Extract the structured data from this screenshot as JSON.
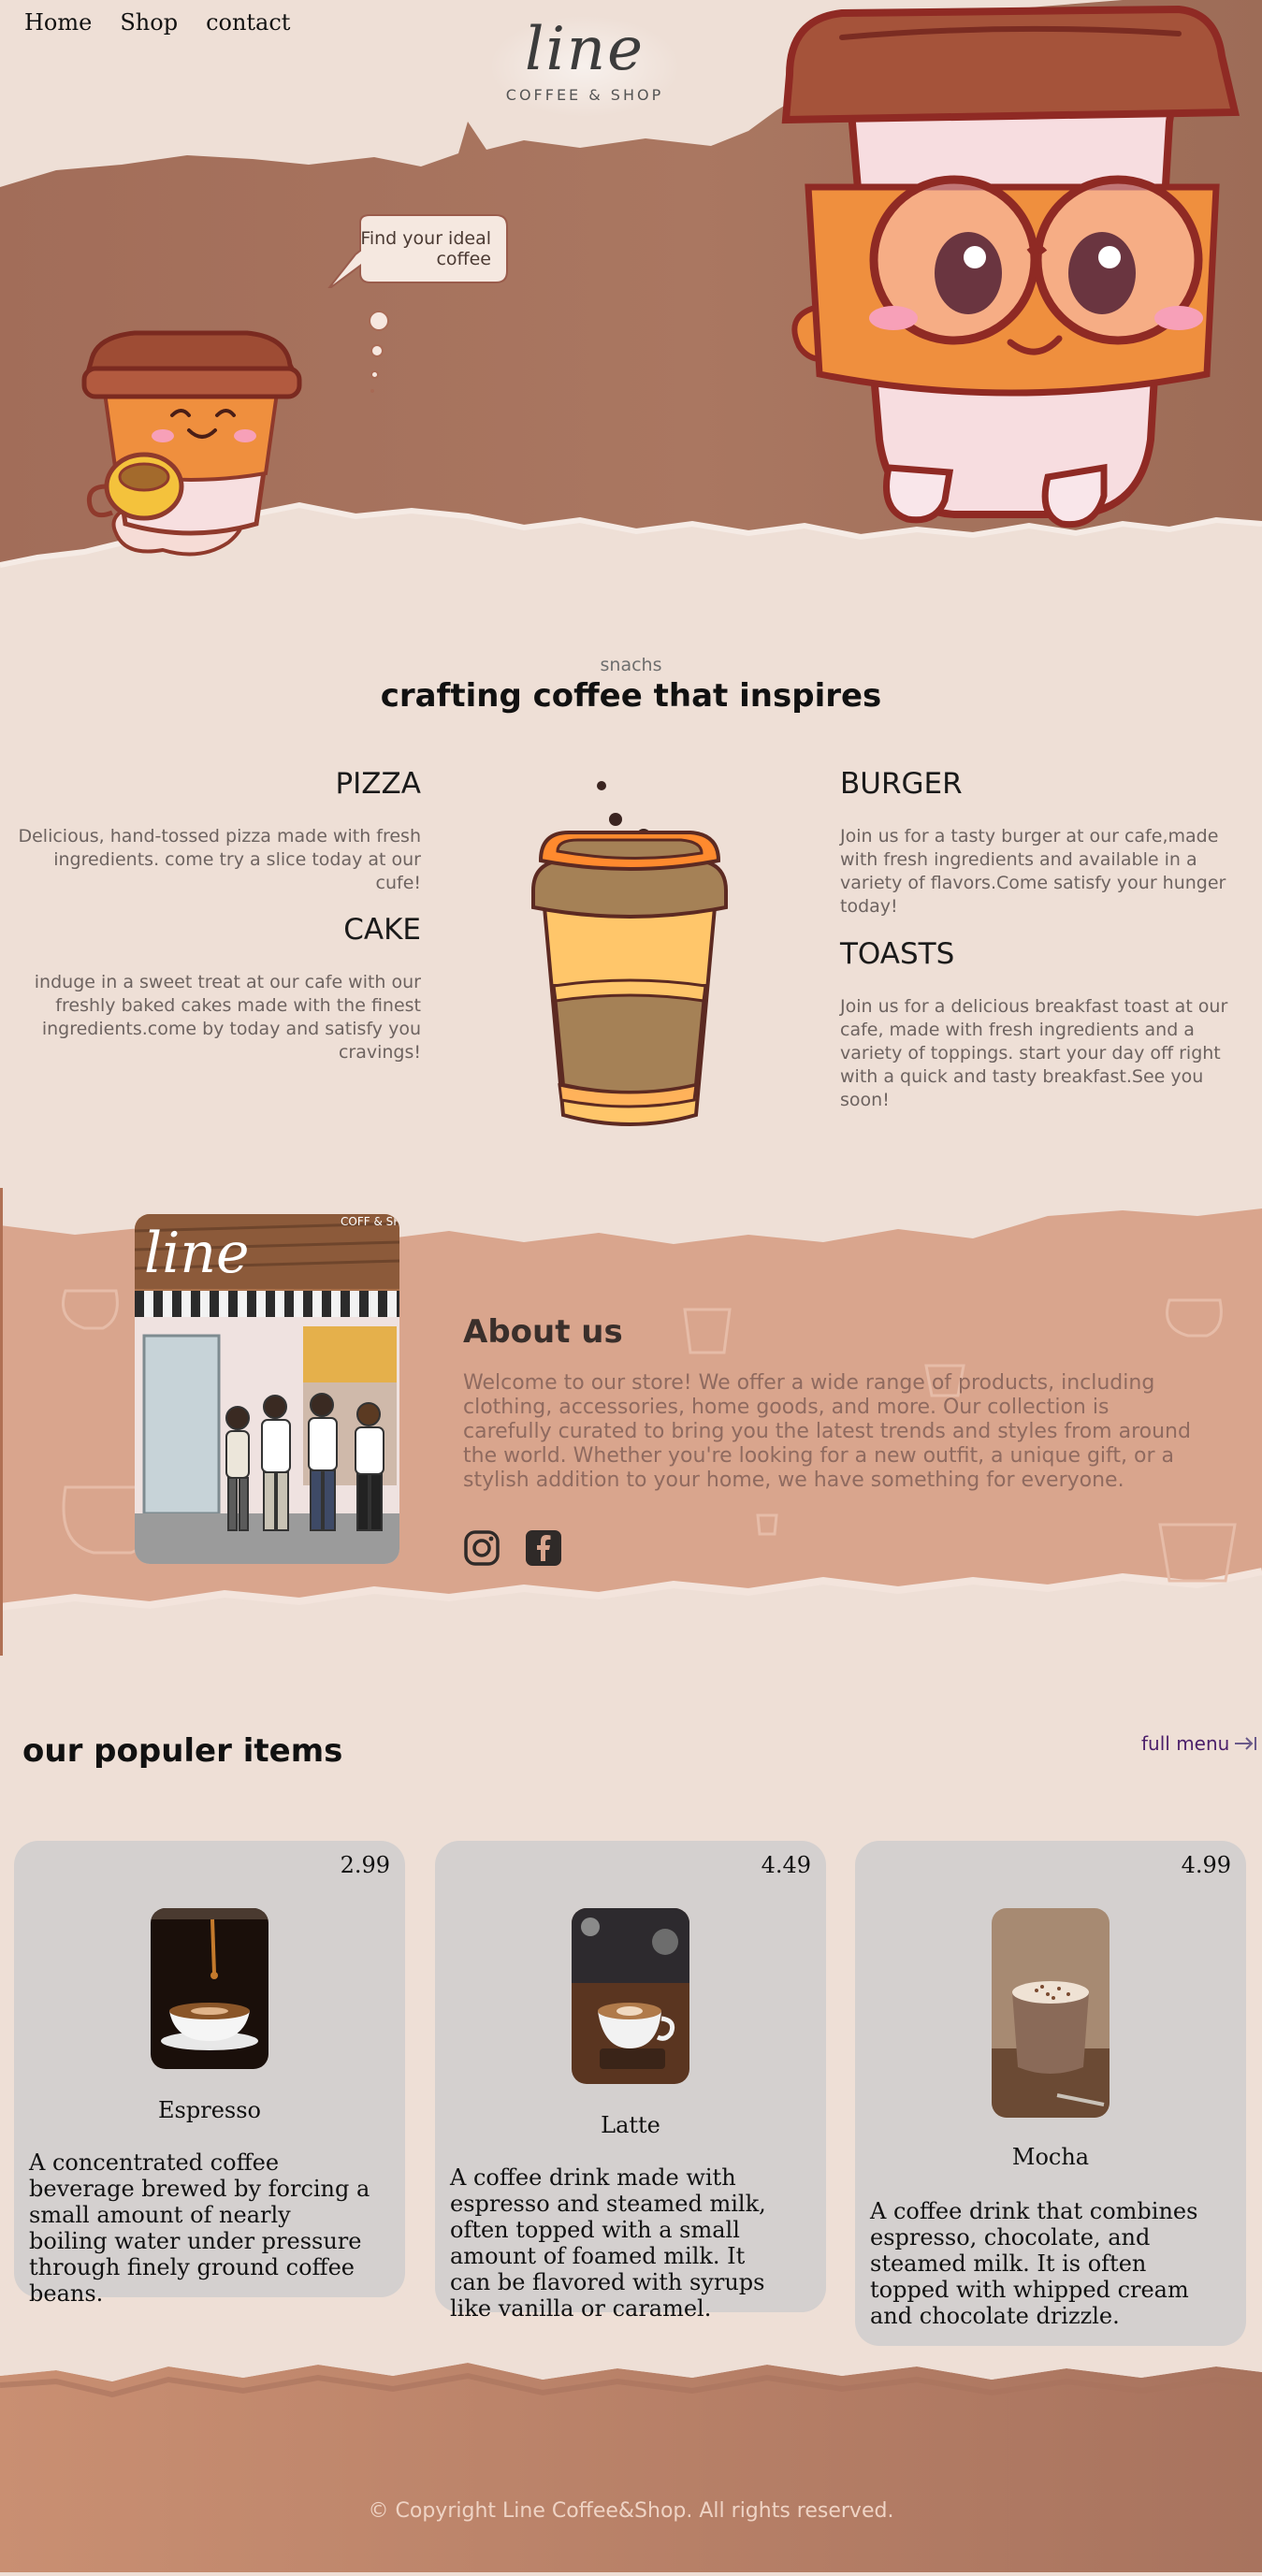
{
  "nav": {
    "items": [
      "Home",
      "Shop",
      "contact"
    ]
  },
  "logo": {
    "script": "line",
    "tagline": "COFFEE & SHOP"
  },
  "hero": {
    "speech_bubble": "Find your ideal coffee"
  },
  "snacks": {
    "kicker": "snachs",
    "title": "crafting coffee that inspires",
    "items": [
      {
        "title": "PIZZA",
        "text": "Delicious, hand-tossed pizza made with fresh ingredients. come try a slice today at our cufe!"
      },
      {
        "title": "CAKE",
        "text": "induge in a sweet treat at our cafe with our freshly baked cakes made with the finest ingredients.come by today and satisfy you cravings!"
      },
      {
        "title": "BURGER",
        "text": "Join us for a tasty burger at our cafe,made with fresh ingredients and available in a variety of flavors.Come satisfy your hunger today!"
      },
      {
        "title": "TOASTS",
        "text": "Join us for a delicious breakfast toast at our cafe, made with fresh ingredients and a variety of toppings. start your day off right with a quick and tasty breakfast.See you soon!"
      }
    ]
  },
  "about": {
    "title": "About us",
    "text": "Welcome to our store! We offer a wide range of products, including clothing, accessories, home goods, and more. Our collection is carefully curated to bring you the latest trends and styles from around the world. Whether you're looking for a new outfit, a unique gift, or a stylish addition to your home, we have something for everyone.",
    "photo_sign": "line",
    "photo_sign_right": "COFF & SHOP",
    "social": [
      "instagram-icon",
      "facebook-icon"
    ]
  },
  "popular": {
    "title": "our populer items",
    "full_menu": "full menu",
    "items": [
      {
        "price": "2.99",
        "name": "Espresso",
        "desc": "A concentrated coffee beverage brewed by forcing a small amount of nearly boiling water under pressure through finely ground coffee beans."
      },
      {
        "price": "4.49",
        "name": "Latte",
        "desc": "A coffee drink made with espresso and steamed milk, often topped with a small amount of foamed milk. It can be flavored with syrups like vanilla or caramel."
      },
      {
        "price": "4.99",
        "name": "Mocha",
        "desc": "A coffee drink that combines espresso, chocolate, and steamed milk. It is often topped with whipped cream and chocolate drizzle."
      }
    ]
  },
  "footer": {
    "copyright": "© Copyright Line Coffee&Shop. All rights reserved."
  },
  "colors": {
    "background": "#eedfd6",
    "hero_brown": "#a8735e",
    "about_band": "#d8a48c",
    "card": "#d4d0cf",
    "footer_brown": "#b98064"
  }
}
